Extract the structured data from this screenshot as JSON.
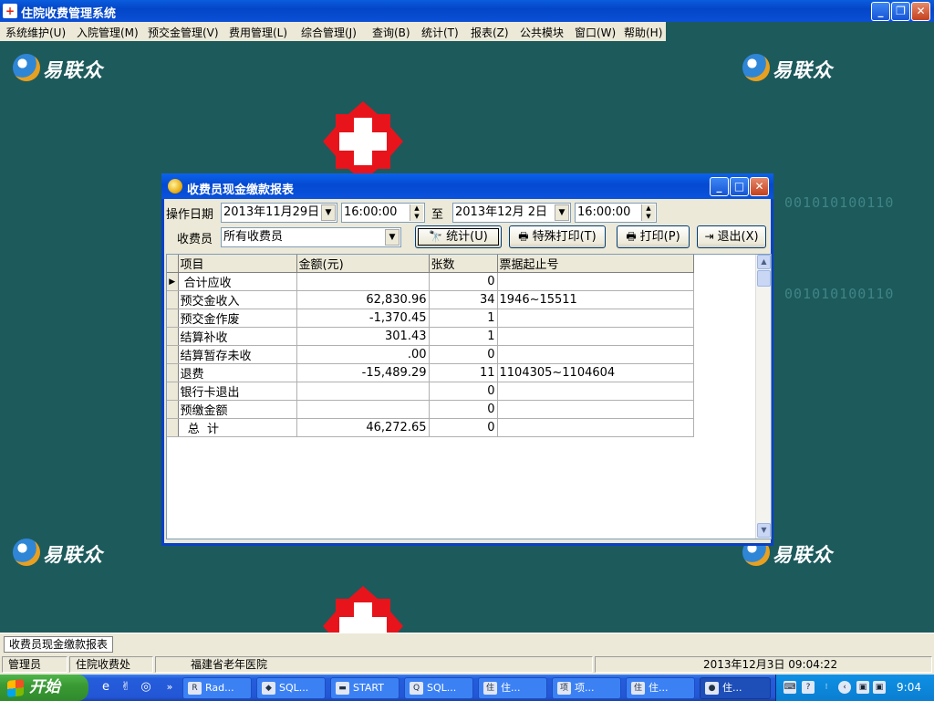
{
  "app": {
    "title": "住院收费管理系统",
    "icon_glyph": "+"
  },
  "menu": [
    {
      "label": "系统维护(U)"
    },
    {
      "label": "入院管理(M)"
    },
    {
      "label": "预交金管理(V)"
    },
    {
      "label": "费用管理(L)"
    },
    {
      "label": "综合管理(J)"
    },
    {
      "label": "查询(B)"
    },
    {
      "label": "统计(T)"
    },
    {
      "label": "报表(Z)"
    },
    {
      "label": "公共模块"
    },
    {
      "label": "窗口(W)"
    },
    {
      "label": "帮助(H)"
    }
  ],
  "desktop": {
    "logo_text": "易联众",
    "binary_text": "001010100110",
    "background_color": "#1d5a5c"
  },
  "dialog": {
    "title": "收费员现金缴款报表",
    "date_label": "操作日期",
    "start_date": "2013年11月29日",
    "start_time": "16:00:00",
    "to_label": "至",
    "end_date": "2013年12月 2日",
    "end_time": "16:00:00",
    "cashier_label": "收费员",
    "cashier_value": "所有收费员",
    "buttons": {
      "stat": "统计(U)",
      "special_print": "特殊打印(T)",
      "print": "打印(P)",
      "exit": "退出(X)"
    },
    "table": {
      "columns": [
        "项目",
        "金额(元)",
        "张数",
        "票据起止号"
      ],
      "rows": [
        {
          "item": " 合计应收",
          "amount": "",
          "count": "0",
          "ticket": "",
          "current": true
        },
        {
          "item": "预交金收入",
          "amount": "62,830.96",
          "count": "34",
          "ticket": "1946~15511"
        },
        {
          "item": "预交金作废",
          "amount": "-1,370.45",
          "count": "1",
          "ticket": ""
        },
        {
          "item": "结算补收",
          "amount": "301.43",
          "count": "1",
          "ticket": ""
        },
        {
          "item": "结算暂存未收",
          "amount": ".00",
          "count": "0",
          "ticket": ""
        },
        {
          "item": "退费",
          "amount": "-15,489.29",
          "count": "11",
          "ticket": "1104305~1104604"
        },
        {
          "item": "银行卡退出",
          "amount": "",
          "count": "0",
          "ticket": ""
        },
        {
          "item": "预缴金额",
          "amount": "",
          "count": "0",
          "ticket": ""
        },
        {
          "item": "  总  计",
          "amount": "46,272.65",
          "count": "0",
          "ticket": ""
        }
      ]
    }
  },
  "window_tab": "收费员现金缴款报表",
  "status": {
    "user": "管理员",
    "dept": "住院收费处",
    "hospital": "福建省老年医院",
    "datetime": "2013年12月3日 09:04:22"
  },
  "taskbar": {
    "start": "开始",
    "tasks": [
      {
        "label": "Rad...",
        "icon": "R"
      },
      {
        "label": "SQL...",
        "icon": "◆"
      },
      {
        "label": "START",
        "icon": "▬"
      },
      {
        "label": "SQL...",
        "icon": "Q"
      },
      {
        "label": "住...",
        "icon": "住"
      },
      {
        "label": "项...",
        "icon": "项"
      },
      {
        "label": "住...",
        "icon": "住"
      },
      {
        "label": "住...",
        "icon": "●",
        "active": true
      }
    ],
    "clock": "9:04"
  }
}
